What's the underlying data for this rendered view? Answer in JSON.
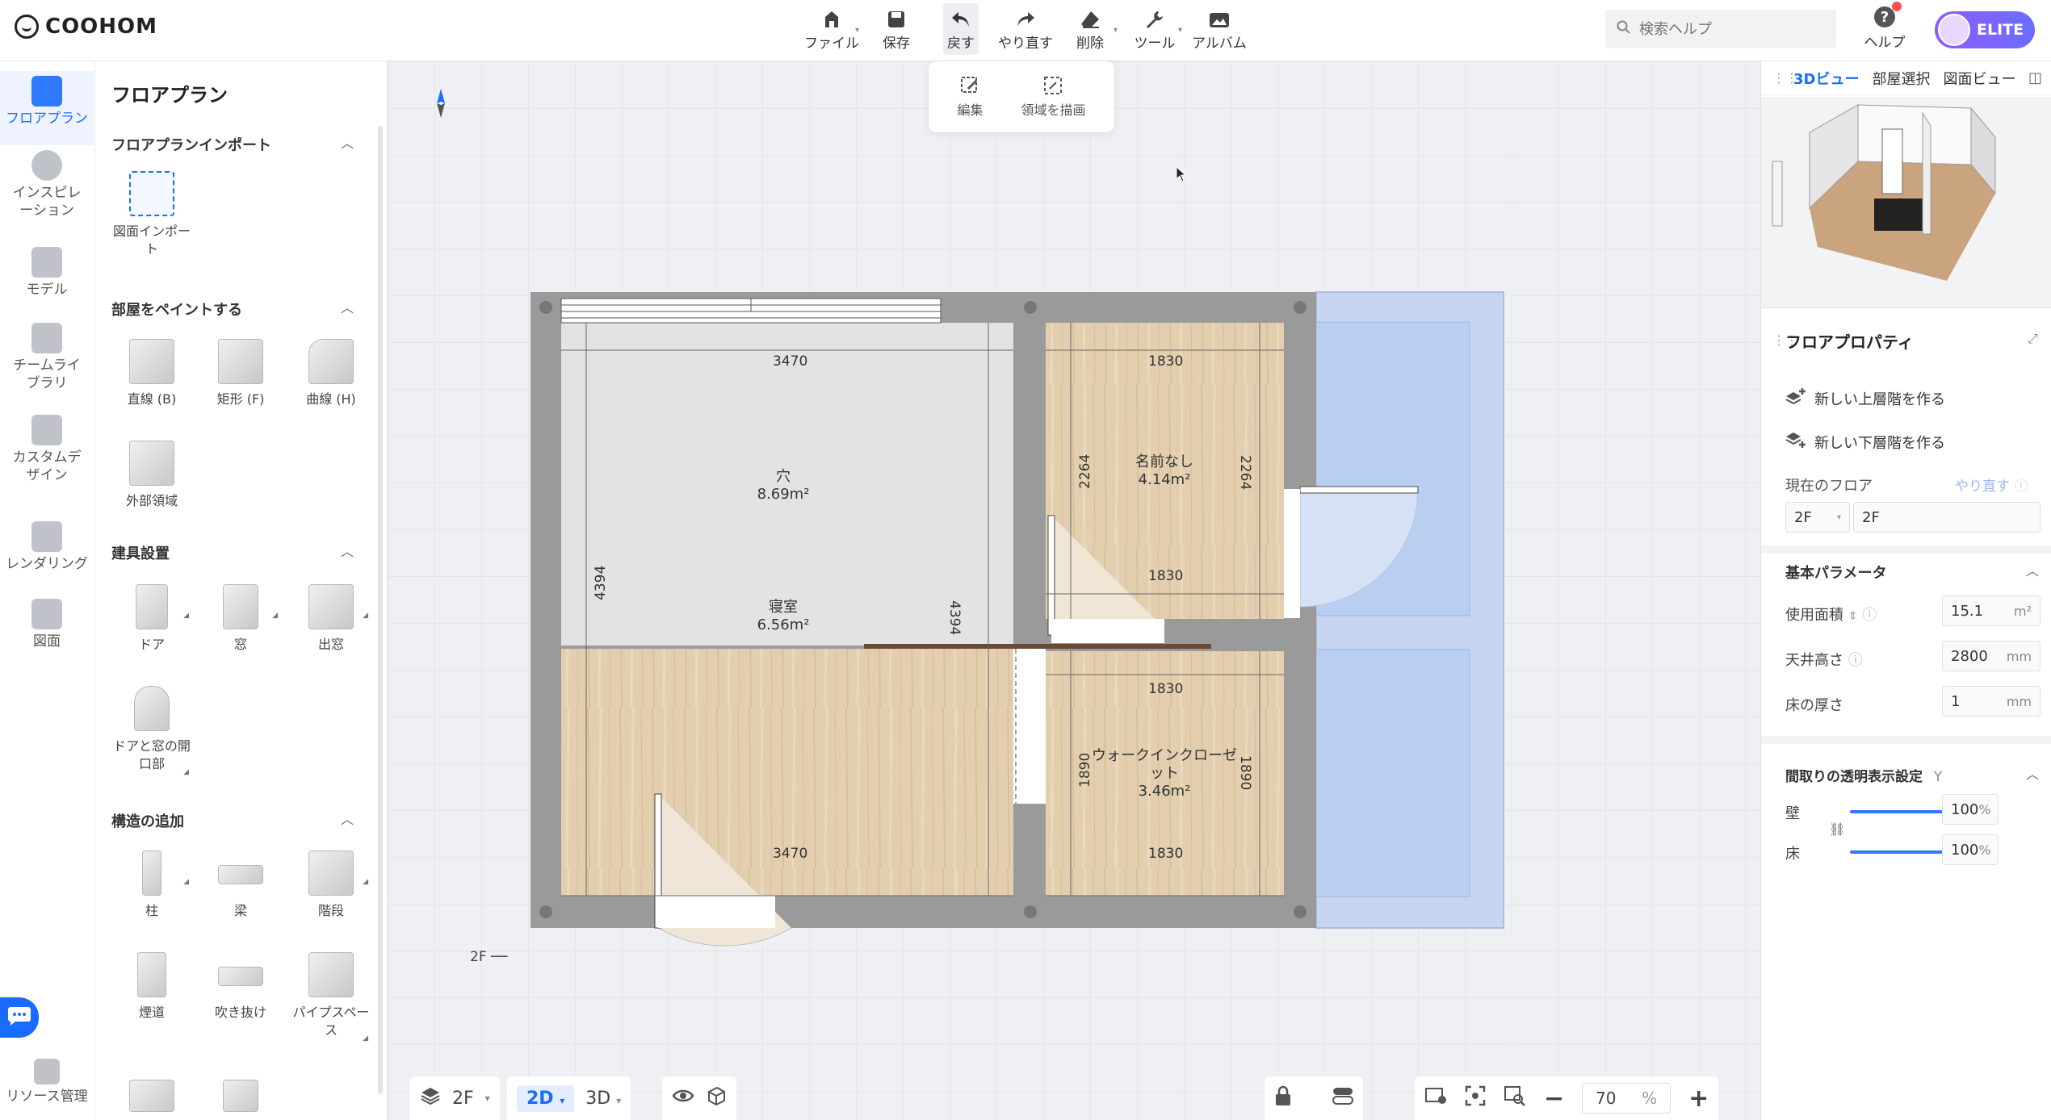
{
  "app": {
    "logo": "COOHOM"
  },
  "toolbar": {
    "file": "ファイル",
    "save": "保存",
    "undo": "戻す",
    "redo": "やり直す",
    "delete": "削除",
    "tools": "ツール",
    "album": "アルバム"
  },
  "search": {
    "placeholder": "検索ヘルプ"
  },
  "help": {
    "label": "ヘルプ"
  },
  "account": {
    "badge": "ELITE"
  },
  "rail": {
    "items": [
      {
        "label": "フロアプラン"
      },
      {
        "label": "インスピレーション"
      },
      {
        "label": "モデル"
      },
      {
        "label": "チームライブラリ"
      },
      {
        "label": "カスタムデザイン"
      },
      {
        "label": "レンダリング"
      },
      {
        "label": "図面"
      },
      {
        "label": "リソース管理"
      }
    ]
  },
  "library": {
    "title": "フロアプラン",
    "import_section": "フロアプランインポート",
    "import_tile": "図面インポート",
    "paint_section": "部屋をペイントする",
    "paint_tiles": [
      "直線 (B)",
      "矩形 (F)",
      "曲線 (H)",
      "外部領域"
    ],
    "fixture_section": "建具設置",
    "fixture_tiles": [
      "ドア",
      "窓",
      "出窓",
      "ドアと窓の開口部"
    ],
    "structure_section": "構造の追加",
    "structure_tiles": [
      "柱",
      "梁",
      "階段",
      "煙道",
      "吹き抜け",
      "パイプスペース"
    ]
  },
  "canvas": {
    "subtools": [
      "編集",
      "領域を描画"
    ],
    "floor_tag": "2F",
    "rooms": [
      {
        "name": "穴",
        "area": "8.69m²"
      },
      {
        "name": "寝室",
        "area": "6.56m²"
      },
      {
        "name": "名前なし",
        "area": "4.14m²"
      },
      {
        "name": "ウォークインクローゼット",
        "area": "3.46m²"
      }
    ],
    "dims": {
      "top_left": "3470",
      "bottom_left": "3470",
      "left_height": "4394",
      "mid_height": "4394",
      "room_top": "1830",
      "room_top_bottom": "1830",
      "room_top_left_h": "2264",
      "room_top_right_h": "2264",
      "closet_top": "1830",
      "closet_bottom": "1830",
      "closet_left_h": "1890",
      "closet_right_h": "1890"
    }
  },
  "bottombar": {
    "floor": "2F",
    "view2d": "2D",
    "view3d": "3D",
    "zoom_value": "70",
    "zoom_unit": "%"
  },
  "right_panel": {
    "tabs": [
      "3Dビュー",
      "部屋選択",
      "図面ビュー"
    ],
    "title": "フロアプロパティ",
    "new_upper": "新しい上層階を作る",
    "new_lower": "新しい下層階を作る",
    "current_floor_label": "現在のフロア",
    "redo_label": "やり直す",
    "floor_select": "2F",
    "floor_name": "2F",
    "basic_section": "基本パラメータ",
    "area_label": "使用面積",
    "area_value": "15.1",
    "area_unit": "m²",
    "ceiling_label": "天井高さ",
    "ceiling_value": "2800",
    "ceiling_unit": "mm",
    "floor_thick_label": "床の厚さ",
    "floor_thick_value": "1",
    "floor_thick_unit": "mm",
    "transparency_section": "間取りの透明表示設定",
    "transparency_key": "Y",
    "wall_label": "壁",
    "wall_value": "100",
    "floor_label": "床",
    "floor_value": "100",
    "percent": "%"
  }
}
